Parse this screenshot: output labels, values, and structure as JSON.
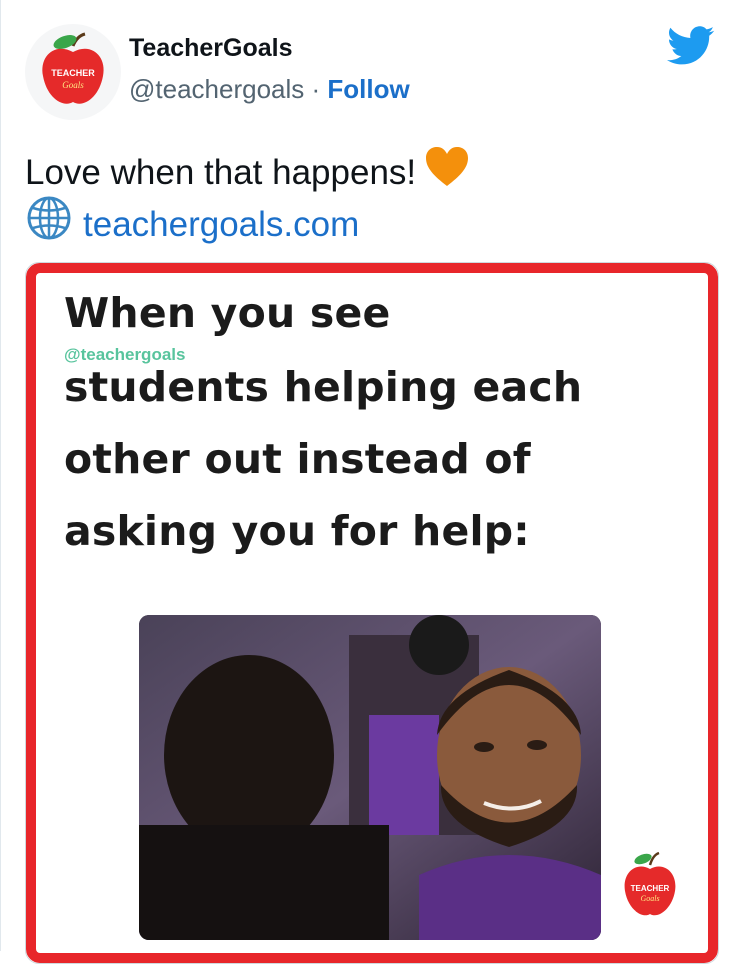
{
  "author": {
    "name": "TeacherGoals",
    "handle": "@teachergoals",
    "separator": " · ",
    "follow_label": "Follow",
    "avatar_text_top": "TEACHER",
    "avatar_text_bottom": "Goals"
  },
  "icons": {
    "platform": "twitter-bird-icon",
    "heart": "orange-heart-emoji",
    "link": "globe-icon"
  },
  "tweet": {
    "text": "Love when that happens!",
    "link_text": "teachergoals.com"
  },
  "meme": {
    "lines": [
      "When you see",
      "students helping each",
      "other out instead of",
      "asking you for help:"
    ],
    "watermark": "@teachergoals",
    "logo_text_top": "TEACHER",
    "logo_text_bottom": "Goals"
  },
  "colors": {
    "brand_blue": "#1d9bf0",
    "link_blue": "#1b6fc9",
    "frame_red": "#e8262a",
    "heart_orange": "#f4900c",
    "watermark_green": "#58c49d"
  }
}
